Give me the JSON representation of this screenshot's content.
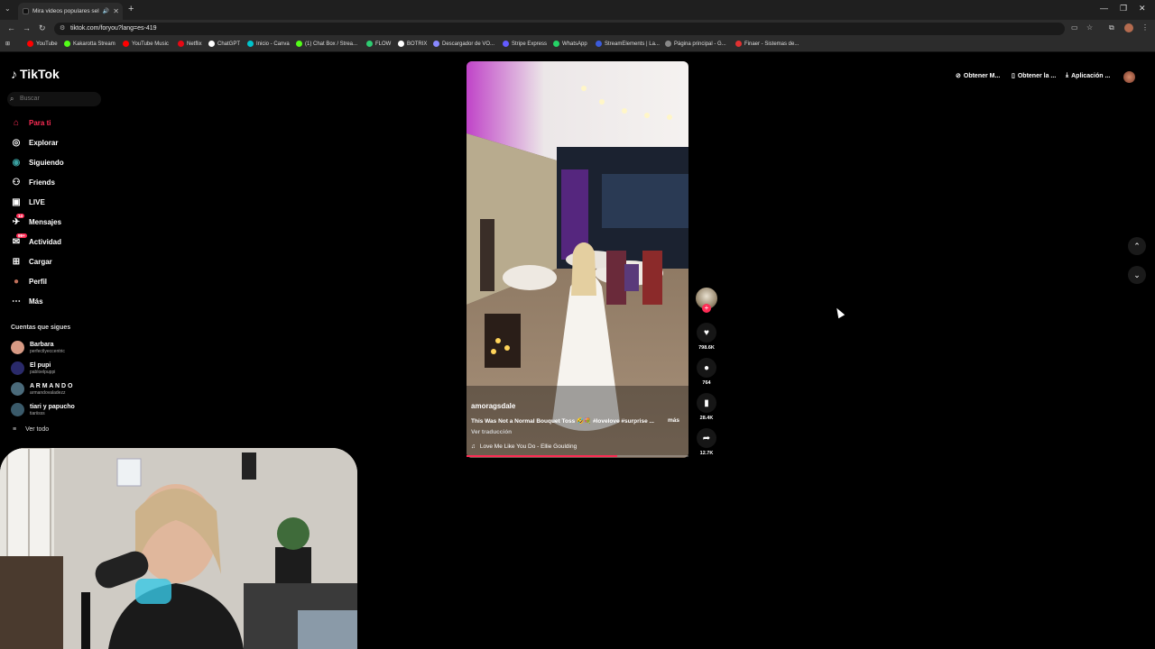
{
  "browser": {
    "tab_title": "Mira videos populares sele...",
    "url": "tiktok.com/foryou?lang=es-419",
    "bookmarks": [
      {
        "label": "YouTube",
        "color": "#ff0000"
      },
      {
        "label": "Kakarotta Stream",
        "color": "#53fc18"
      },
      {
        "label": "YouTube Music",
        "color": "#ff0000"
      },
      {
        "label": "Netflix",
        "color": "#e50914"
      },
      {
        "label": "ChatGPT",
        "color": "#ffffff"
      },
      {
        "label": "Inicio - Canva",
        "color": "#00c4cc"
      },
      {
        "label": "(1) Chat Box / Strea...",
        "color": "#53fc18"
      },
      {
        "label": "FLOW",
        "color": "#2ecc71"
      },
      {
        "label": "BOTRIX",
        "color": "#ffffff"
      },
      {
        "label": "Descargador de VO...",
        "color": "#8888ff"
      },
      {
        "label": "Stripe Express",
        "color": "#635bff"
      },
      {
        "label": "WhatsApp",
        "color": "#25d366"
      },
      {
        "label": "StreamElements | La...",
        "color": "#3b5bdb"
      },
      {
        "label": "Página principal - G...",
        "color": "#888888"
      },
      {
        "label": "Finaer - Sistemas de...",
        "color": "#e03131"
      }
    ]
  },
  "tiktok": {
    "logo": "TikTok",
    "search_placeholder": "Buscar",
    "nav": [
      {
        "label": "Para ti",
        "icon": "home-icon",
        "active": true
      },
      {
        "label": "Explorar",
        "icon": "compass-icon"
      },
      {
        "label": "Siguiendo",
        "icon": "following-icon"
      },
      {
        "label": "Friends",
        "icon": "friends-icon"
      },
      {
        "label": "LIVE",
        "icon": "live-icon"
      },
      {
        "label": "Mensajes",
        "icon": "messages-icon",
        "badge": "14"
      },
      {
        "label": "Actividad",
        "icon": "activity-icon",
        "badge": "99+"
      },
      {
        "label": "Cargar",
        "icon": "upload-icon"
      },
      {
        "label": "Perfil",
        "icon": "profile-icon"
      },
      {
        "label": "Más",
        "icon": "more-icon"
      }
    ],
    "following_heading": "Cuentas que sigues",
    "following": [
      {
        "name": "Barbara",
        "handle": "perfectlyeccentric"
      },
      {
        "name": "El pupi",
        "handle": "pabloelpuppi"
      },
      {
        "name": "A R M A N D O",
        "handle": "armandovaladezz"
      },
      {
        "name": "tiari y papucho",
        "handle": "tiariisss"
      }
    ],
    "see_all": "Ver todo",
    "top_right": [
      "Obtener M...",
      "Obtener la ...",
      "Aplicación ..."
    ],
    "video": {
      "username": "amoragsdale",
      "description": "This Was Not a Normal Bouquet Toss 🤣💐 #lovelove #surprise ...",
      "more": "más",
      "translate": "Ver traducción",
      "music": "Love Me Like You Do - Ellie Goulding",
      "progress": 0.68
    },
    "actions": {
      "likes": "798.6K",
      "comments": "764",
      "saves": "28.4K",
      "shares": "12.7K"
    }
  }
}
